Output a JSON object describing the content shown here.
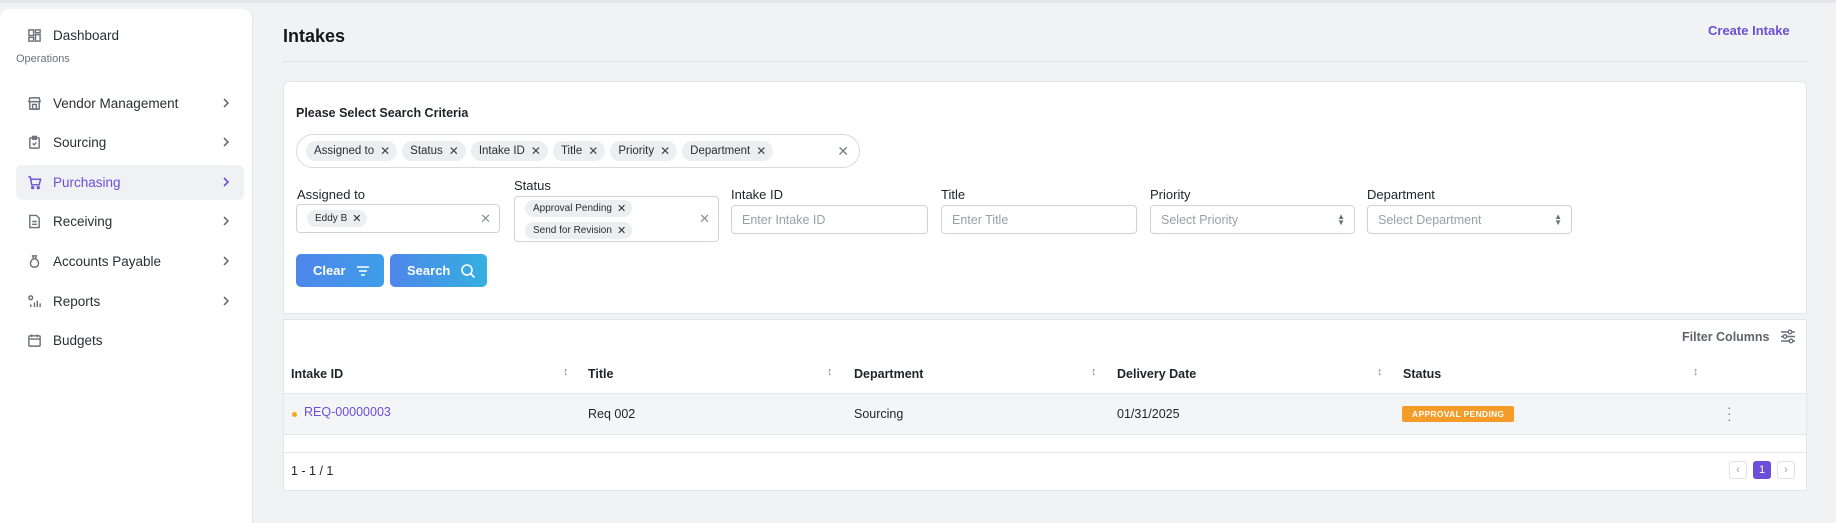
{
  "sidebar": {
    "items": [
      {
        "label": "Dashboard",
        "icon": "dashboard-icon"
      },
      {
        "label": "Vendor Management",
        "icon": "store-icon"
      },
      {
        "label": "Sourcing",
        "icon": "clipboard-icon"
      },
      {
        "label": "Purchasing",
        "icon": "cart-icon"
      },
      {
        "label": "Receiving",
        "icon": "document-icon"
      },
      {
        "label": "Accounts Payable",
        "icon": "money-bag-icon"
      },
      {
        "label": "Reports",
        "icon": "bar-chart-icon"
      },
      {
        "label": "Budgets",
        "icon": "calendar-icon"
      }
    ],
    "section_label": "Operations",
    "active_item": "Purchasing"
  },
  "header": {
    "title": "Intakes",
    "create_label": "Create Intake"
  },
  "search": {
    "title": "Please Select Search Criteria",
    "criteria_chips": [
      "Assigned to",
      "Status",
      "Intake ID",
      "Title",
      "Priority",
      "Department"
    ],
    "assigned_to": {
      "label": "Assigned to",
      "chips": [
        "Eddy B"
      ]
    },
    "status": {
      "label": "Status",
      "chips": [
        "Approval Pending",
        "Send for Revision"
      ]
    },
    "intake_id": {
      "label": "Intake ID",
      "placeholder": "Enter Intake ID"
    },
    "title_field": {
      "label": "Title",
      "placeholder": "Enter Title"
    },
    "priority": {
      "label": "Priority",
      "placeholder": "Select Priority"
    },
    "department": {
      "label": "Department",
      "placeholder": "Select Department"
    },
    "clear_label": "Clear",
    "search_label": "Search"
  },
  "table": {
    "filter_columns_label": "Filter Columns",
    "columns": [
      "Intake ID",
      "Title",
      "Department",
      "Delivery Date",
      "Status"
    ],
    "rows": [
      {
        "intake_id": "REQ-00000003",
        "title": "Req 002",
        "department": "Sourcing",
        "delivery_date": "01/31/2025",
        "status": "APPROVAL PENDING"
      }
    ],
    "range_text": "1 - 1 / 1",
    "current_page": "1",
    "status_color": "#f59b28"
  },
  "colors": {
    "accent": "#6b4fd8",
    "button": "#4f86ea"
  }
}
